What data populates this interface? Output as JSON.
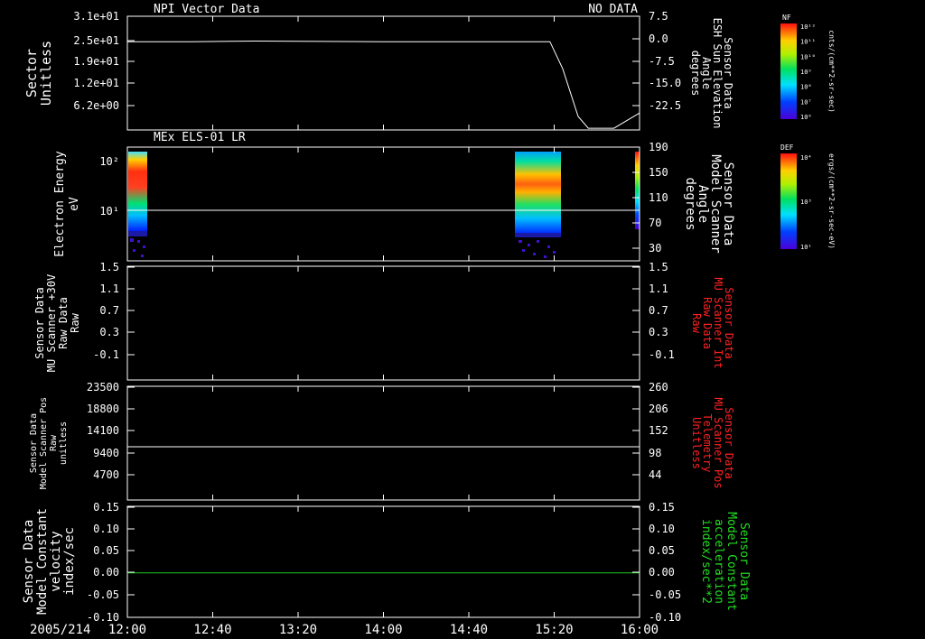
{
  "date_label": "2005/214",
  "time_ticks": [
    "12:00",
    "12:40",
    "13:20",
    "14:00",
    "14:40",
    "15:20",
    "16:00"
  ],
  "panels": [
    {
      "id": "p1",
      "title_left": "NPI Vector Data",
      "title_right": "NO DATA",
      "ylabel_left": [
        "Sector",
        "Unitless"
      ],
      "yticks_left": [
        "3.1e+01",
        "2.5e+01",
        "1.9e+01",
        "1.2e+01",
        "6.2e+00"
      ],
      "ylabel_right": [
        "Sensor Data",
        "ESH Sun Elevation",
        "Angle",
        "degrees"
      ],
      "yticks_right": [
        "7.5",
        "0.0",
        "-7.5",
        "-15.0",
        "-22.5"
      ]
    },
    {
      "id": "p2",
      "title_left": "MEx ELS-01 LR",
      "ylabel_left": [
        "Electron Energy",
        "eV"
      ],
      "yticks_left": [
        "10²",
        "10¹"
      ],
      "ylabel_right": [
        "Sensor Data",
        "Model Scanner",
        "Angle",
        "degrees"
      ],
      "yticks_right": [
        "190",
        "150",
        "110",
        "70",
        "30"
      ]
    },
    {
      "id": "p3",
      "ylabel_left": [
        "Sensor Data",
        "MU Scanner +30V",
        "Raw Data",
        "Raw"
      ],
      "yticks_left": [
        "1.5",
        "1.1",
        "0.7",
        "0.3",
        "-0.1"
      ],
      "ylabel_right": [
        "Sensor Data",
        "MU Scanner Int",
        "Raw Data",
        "Raw"
      ],
      "yticks_right": [
        "1.5",
        "1.1",
        "0.7",
        "0.3",
        "-0.1"
      ]
    },
    {
      "id": "p4",
      "ylabel_left": [
        "Sensor Data",
        "Model Scanner Pos",
        "Raw",
        "unitless"
      ],
      "yticks_left": [
        "23500",
        "18800",
        "14100",
        "9400",
        "4700"
      ],
      "ylabel_right": [
        "Sensor Data",
        "MU Scanner Pos",
        "Telemetry",
        "Unitless"
      ],
      "yticks_right": [
        "260",
        "206",
        "152",
        "98",
        "44"
      ]
    },
    {
      "id": "p5",
      "ylabel_left": [
        "Sensor Data",
        "Model Constant",
        "velocity",
        "index/sec"
      ],
      "yticks_left": [
        "0.15",
        "0.10",
        "0.05",
        "0.00",
        "-0.05",
        "-0.10"
      ],
      "ylabel_right": [
        "Sensor Data",
        "Model Constant",
        "acceleration",
        "index/sec**2"
      ],
      "yticks_right": [
        "0.15",
        "0.10",
        "0.05",
        "0.00",
        "-0.05",
        "-0.10"
      ]
    }
  ],
  "colorbars": [
    {
      "id": "cb1",
      "label": "NF",
      "unit": "cnts/(cm**2-sr-sec)",
      "ticks": [
        "10¹²",
        "10¹¹",
        "10¹⁰",
        "10⁹",
        "10⁸",
        "10⁷",
        "10⁶"
      ]
    },
    {
      "id": "cb2",
      "label": "DEF",
      "unit": "ergs/(cm**2-sr-sec-eV)",
      "ticks": [
        "10⁴",
        "10³",
        "10¹"
      ]
    }
  ],
  "colors": {
    "background": "#000000",
    "axes": "#ffffff",
    "right_label_p3": "#ff2020",
    "right_label_p4": "#ff2020",
    "right_label_p5": "#22dd22",
    "trace_p5": "#22cc22"
  },
  "chart_data": [
    {
      "type": "line",
      "panel": "p1",
      "x_unit": "hours since 12:00",
      "xlim": [
        0,
        4
      ],
      "ylim_right": [
        -26,
        7.5
      ],
      "series": [
        {
          "x": [
            0,
            0.5,
            1.0,
            2.0,
            3.0,
            3.3,
            3.4,
            3.52,
            3.6,
            3.8,
            4.0
          ],
          "y": [
            0.0,
            0.0,
            0.2,
            0.0,
            0.0,
            0.0,
            -8.0,
            -22.0,
            -25.5,
            -25.5,
            -21.0
          ]
        }
      ]
    },
    {
      "type": "heatmap",
      "panel": "p2",
      "xlim": [
        0,
        4
      ],
      "ylabel": "Electron Energy eV",
      "y_scale": "log",
      "ylim": [
        3,
        180
      ],
      "data_intervals": [
        [
          0.0,
          0.23
        ],
        [
          3.0,
          3.55
        ]
      ],
      "overlay_line_right_deg": 90,
      "right_ylim": [
        10,
        190
      ]
    },
    {
      "type": "line",
      "panel": "p4",
      "xlim": [
        0,
        4
      ],
      "ylim": [
        0,
        23500
      ],
      "series": [
        {
          "x": [
            0,
            4
          ],
          "y": [
            11000,
            11000
          ]
        }
      ]
    },
    {
      "type": "line",
      "panel": "p5",
      "xlim": [
        0,
        4
      ],
      "ylim": [
        -0.1,
        0.15
      ],
      "series": [
        {
          "x": [
            0,
            4
          ],
          "y": [
            0.0,
            0.0
          ]
        }
      ]
    }
  ]
}
